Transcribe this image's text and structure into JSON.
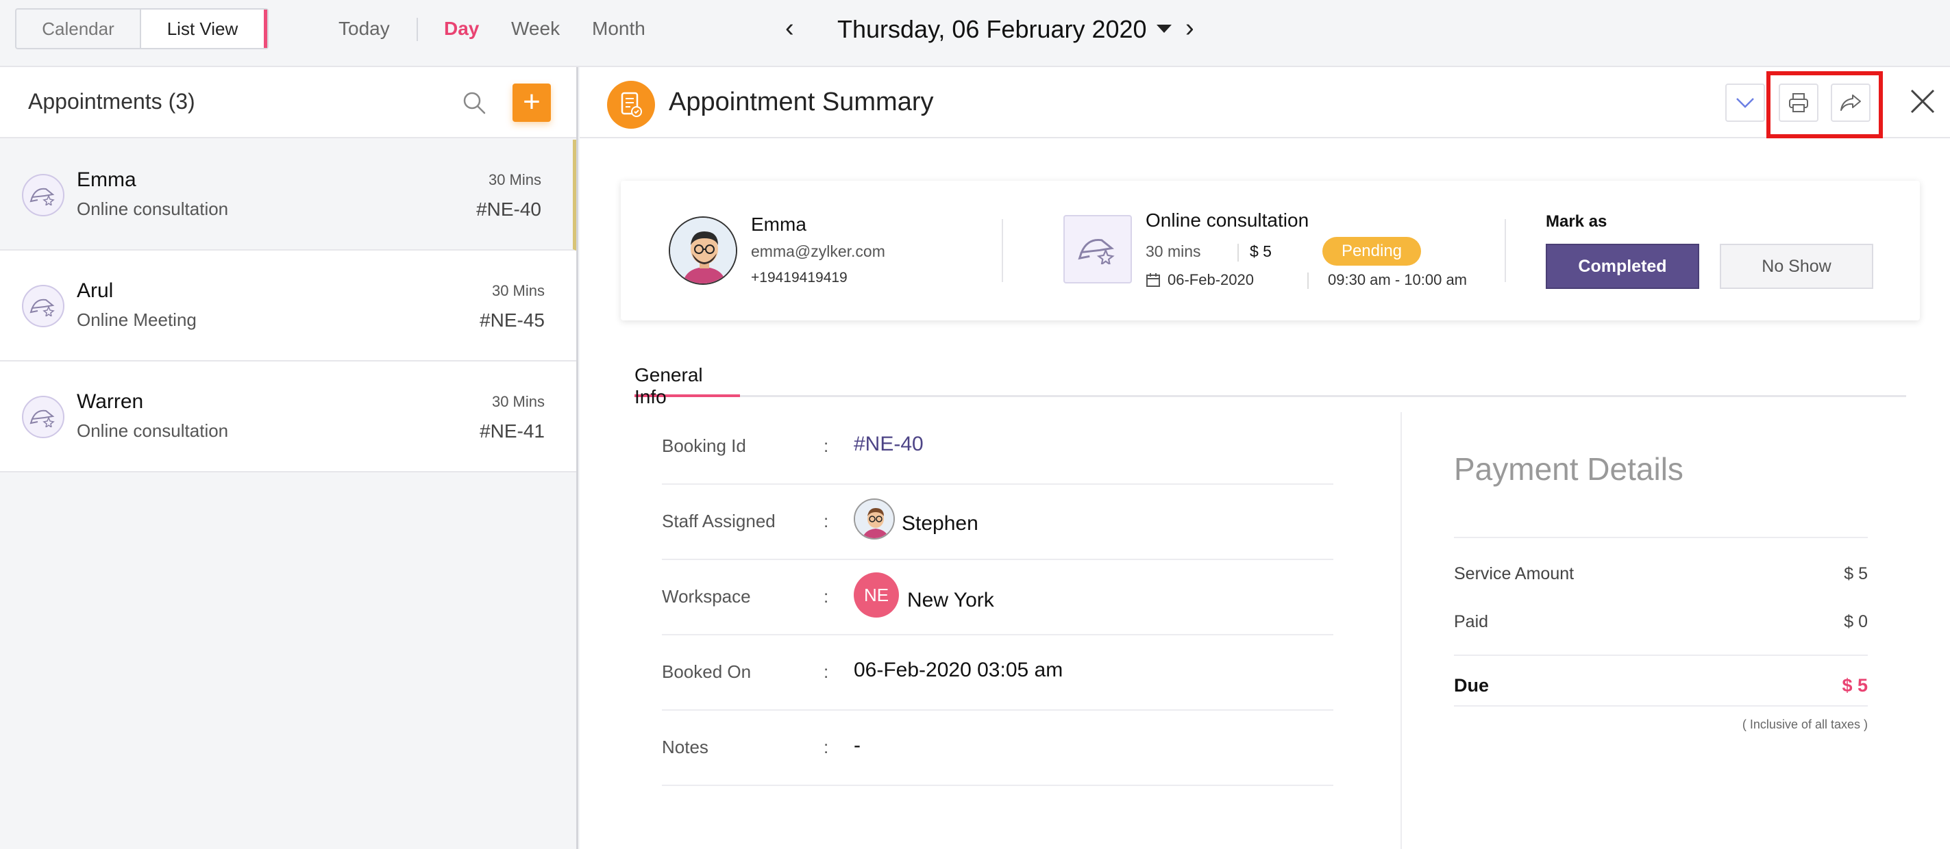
{
  "topbar": {
    "view_toggle": [
      "Calendar",
      "List View"
    ],
    "nav": [
      "Today",
      "Day",
      "Week",
      "Month"
    ],
    "active_nav": "Day",
    "date": "Thursday, 06 February 2020",
    "prev": "‹",
    "next": "›"
  },
  "appointments": {
    "title": "Appointments (3)",
    "add_label": "+",
    "items": [
      {
        "name": "Emma",
        "service": "Online consultation",
        "duration": "30 Mins",
        "id": "#NE-40"
      },
      {
        "name": "Arul",
        "service": "Online Meeting",
        "duration": "30 Mins",
        "id": "#NE-45"
      },
      {
        "name": "Warren",
        "service": "Online consultation",
        "duration": "30 Mins",
        "id": "#NE-41"
      }
    ]
  },
  "summary": {
    "title": "Appointment Summary",
    "customer": {
      "name": "Emma",
      "email": "emma@zylker.com",
      "phone": "+19419419419"
    },
    "service": {
      "name": "Online consultation",
      "duration": "30 mins",
      "price": "$ 5",
      "status": "Pending",
      "date": "06-Feb-2020",
      "time": "09:30 am - 10:00 am"
    },
    "mark_as": {
      "label": "Mark as",
      "completed": "Completed",
      "no_show": "No Show"
    },
    "tab": "General Info",
    "info": [
      {
        "label": "Booking Id",
        "value": "#NE-40"
      },
      {
        "label": "Staff Assigned",
        "value": "Stephen"
      },
      {
        "label": "Workspace",
        "value": "New York",
        "badge": "NE"
      },
      {
        "label": "Booked On",
        "value": "06-Feb-2020 03:05 am"
      },
      {
        "label": "Notes",
        "value": "-"
      }
    ],
    "colon": ":",
    "payment": {
      "title": "Payment Details",
      "service_amount_label": "Service Amount",
      "service_amount": "$ 5",
      "paid_label": "Paid",
      "paid": "$ 0",
      "due_label": "Due",
      "due": "$ 5",
      "note": "( Inclusive of all taxes )"
    }
  },
  "colors": {
    "accent": "#e94372",
    "brand_orange": "#f7931e",
    "purple": "#5b4e8c",
    "pending": "#f6b73c"
  }
}
